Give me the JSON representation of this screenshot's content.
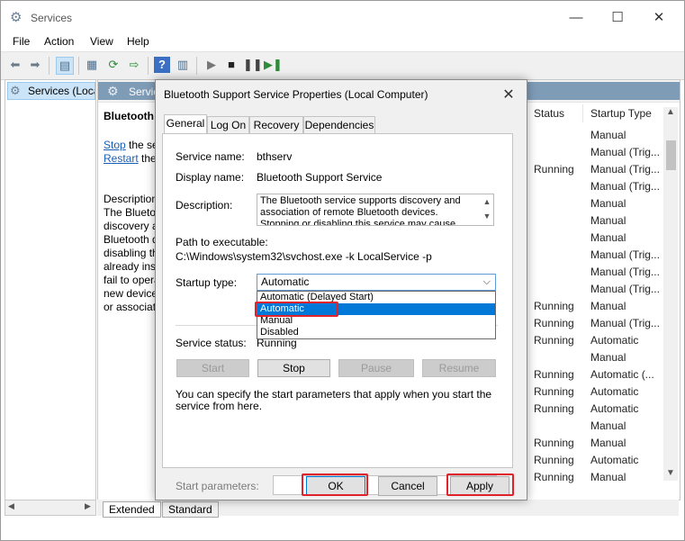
{
  "window": {
    "title": "Services",
    "controls": [
      "—",
      "☐",
      "✕"
    ]
  },
  "menu": [
    "File",
    "Action",
    "View",
    "Help"
  ],
  "colors": {
    "accent": "#0078d7",
    "highlight": "#e0232a",
    "link": "#1a5fb4"
  },
  "tree": {
    "item": "Services (Local)"
  },
  "panel": {
    "header": "Services (Local)",
    "service_title": "Bluetooth Support Service",
    "stop_link": "Stop",
    "stop_rest": " the service",
    "restart_link": "Restart",
    "restart_rest": " the service",
    "description_lines": [
      "Description:",
      "The Bluetooth service supports",
      "discovery and association of remote",
      "Bluetooth devices. Stopping or",
      "disabling this service may cause",
      "already installed Bluetooth devices to",
      "fail to operate properly and prevent",
      "new devices from being discovered",
      "or associated."
    ],
    "columns": {
      "status": "Status",
      "startup": "Startup Type"
    },
    "rows": [
      {
        "status": "",
        "startup": "Manual"
      },
      {
        "status": "",
        "startup": "Manual (Trig..."
      },
      {
        "status": "Running",
        "startup": "Manual (Trig..."
      },
      {
        "status": "",
        "startup": "Manual (Trig..."
      },
      {
        "status": "",
        "startup": "Manual"
      },
      {
        "status": "",
        "startup": "Manual"
      },
      {
        "status": "",
        "startup": "Manual"
      },
      {
        "status": "",
        "startup": "Manual (Trig..."
      },
      {
        "status": "",
        "startup": "Manual (Trig..."
      },
      {
        "status": "",
        "startup": "Manual (Trig..."
      },
      {
        "status": "Running",
        "startup": "Manual"
      },
      {
        "status": "Running",
        "startup": "Manual (Trig..."
      },
      {
        "status": "Running",
        "startup": "Automatic"
      },
      {
        "status": "",
        "startup": "Manual"
      },
      {
        "status": "Running",
        "startup": "Automatic (..."
      },
      {
        "status": "Running",
        "startup": "Automatic"
      },
      {
        "status": "Running",
        "startup": "Automatic"
      },
      {
        "status": "",
        "startup": "Manual"
      },
      {
        "status": "Running",
        "startup": "Manual"
      },
      {
        "status": "Running",
        "startup": "Automatic"
      },
      {
        "status": "Running",
        "startup": "Manual"
      }
    ],
    "bottom_tabs": [
      "Extended",
      "Standard"
    ]
  },
  "dialog": {
    "title": "Bluetooth Support Service Properties (Local Computer)",
    "tabs": [
      "General",
      "Log On",
      "Recovery",
      "Dependencies"
    ],
    "service_name_label": "Service name:",
    "service_name": "bthserv",
    "display_name_label": "Display name:",
    "display_name": "Bluetooth Support Service",
    "description_label": "Description:",
    "description": "The Bluetooth service supports discovery and association of remote Bluetooth devices.  Stopping or disabling this service may cause already installed",
    "path_label": "Path to executable:",
    "path": "C:\\Windows\\system32\\svchost.exe -k LocalService -p",
    "startup_label": "Startup type:",
    "startup_value": "Automatic",
    "startup_options": [
      "Automatic (Delayed Start)",
      "Automatic",
      "Manual",
      "Disabled"
    ],
    "service_status_label": "Service status:",
    "service_status": "Running",
    "buttons": {
      "start": "Start",
      "stop": "Stop",
      "pause": "Pause",
      "resume": "Resume"
    },
    "hint": "You can specify the start parameters that apply when you start the service from here.",
    "start_params_label": "Start parameters:",
    "start_params_value": "",
    "ok": "OK",
    "cancel": "Cancel",
    "apply": "Apply"
  }
}
